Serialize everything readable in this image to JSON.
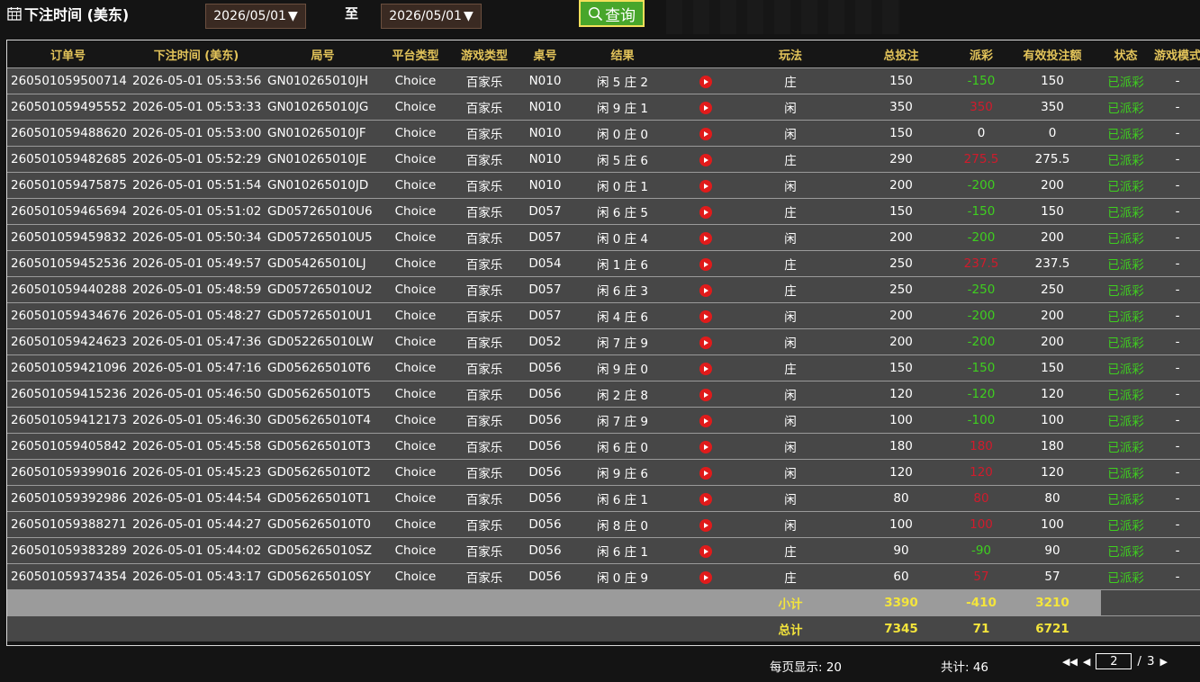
{
  "header": {
    "title": "下注时间 (美东)",
    "calendar_icon": "calendar-icon",
    "date_from": "2026/05/01",
    "to_label": "至",
    "date_to": "2026/05/01",
    "dropdown_glyph": "▼",
    "search_label": "查询",
    "search_icon": "search-icon"
  },
  "columns": [
    "订单号",
    "下注时间 (美东)",
    "局号",
    "平台类型",
    "游戏类型",
    "桌号",
    "结果",
    "",
    "玩法",
    "总投注",
    "派彩",
    "有效投注额",
    "状态",
    "游戏模式"
  ],
  "rows": [
    [
      "260501059500714",
      "2026-05-01 05:53:56",
      "GN010265010JH",
      "Choice",
      "百家乐",
      "N010",
      "闲 5 庄 2",
      "庄",
      "150",
      "-150",
      "150",
      "已派彩",
      "-"
    ],
    [
      "260501059495552",
      "2026-05-01 05:53:33",
      "GN010265010JG",
      "Choice",
      "百家乐",
      "N010",
      "闲 9 庄 1",
      "闲",
      "350",
      "350",
      "350",
      "已派彩",
      "-"
    ],
    [
      "260501059488620",
      "2026-05-01 05:53:00",
      "GN010265010JF",
      "Choice",
      "百家乐",
      "N010",
      "闲 0 庄 0",
      "闲",
      "150",
      "0",
      "0",
      "已派彩",
      "-"
    ],
    [
      "260501059482685",
      "2026-05-01 05:52:29",
      "GN010265010JE",
      "Choice",
      "百家乐",
      "N010",
      "闲 5 庄 6",
      "庄",
      "290",
      "275.5",
      "275.5",
      "已派彩",
      "-"
    ],
    [
      "260501059475875",
      "2026-05-01 05:51:54",
      "GN010265010JD",
      "Choice",
      "百家乐",
      "N010",
      "闲 0 庄 1",
      "闲",
      "200",
      "-200",
      "200",
      "已派彩",
      "-"
    ],
    [
      "260501059465694",
      "2026-05-01 05:51:02",
      "GD057265010U6",
      "Choice",
      "百家乐",
      "D057",
      "闲 6 庄 5",
      "庄",
      "150",
      "-150",
      "150",
      "已派彩",
      "-"
    ],
    [
      "260501059459832",
      "2026-05-01 05:50:34",
      "GD057265010U5",
      "Choice",
      "百家乐",
      "D057",
      "闲 0 庄 4",
      "闲",
      "200",
      "-200",
      "200",
      "已派彩",
      "-"
    ],
    [
      "260501059452536",
      "2026-05-01 05:49:57",
      "GD054265010LJ",
      "Choice",
      "百家乐",
      "D054",
      "闲 1 庄 6",
      "庄",
      "250",
      "237.5",
      "237.5",
      "已派彩",
      "-"
    ],
    [
      "260501059440288",
      "2026-05-01 05:48:59",
      "GD057265010U2",
      "Choice",
      "百家乐",
      "D057",
      "闲 6 庄 3",
      "庄",
      "250",
      "-250",
      "250",
      "已派彩",
      "-"
    ],
    [
      "260501059434676",
      "2026-05-01 05:48:27",
      "GD057265010U1",
      "Choice",
      "百家乐",
      "D057",
      "闲 4 庄 6",
      "闲",
      "200",
      "-200",
      "200",
      "已派彩",
      "-"
    ],
    [
      "260501059424623",
      "2026-05-01 05:47:36",
      "GD052265010LW",
      "Choice",
      "百家乐",
      "D052",
      "闲 7 庄 9",
      "闲",
      "200",
      "-200",
      "200",
      "已派彩",
      "-"
    ],
    [
      "260501059421096",
      "2026-05-01 05:47:16",
      "GD056265010T6",
      "Choice",
      "百家乐",
      "D056",
      "闲 9 庄 0",
      "庄",
      "150",
      "-150",
      "150",
      "已派彩",
      "-"
    ],
    [
      "260501059415236",
      "2026-05-01 05:46:50",
      "GD056265010T5",
      "Choice",
      "百家乐",
      "D056",
      "闲 2 庄 8",
      "闲",
      "120",
      "-120",
      "120",
      "已派彩",
      "-"
    ],
    [
      "260501059412173",
      "2026-05-01 05:46:30",
      "GD056265010T4",
      "Choice",
      "百家乐",
      "D056",
      "闲 7 庄 9",
      "闲",
      "100",
      "-100",
      "100",
      "已派彩",
      "-"
    ],
    [
      "260501059405842",
      "2026-05-01 05:45:58",
      "GD056265010T3",
      "Choice",
      "百家乐",
      "D056",
      "闲 6 庄 0",
      "闲",
      "180",
      "180",
      "180",
      "已派彩",
      "-"
    ],
    [
      "260501059399016",
      "2026-05-01 05:45:23",
      "GD056265010T2",
      "Choice",
      "百家乐",
      "D056",
      "闲 9 庄 6",
      "闲",
      "120",
      "120",
      "120",
      "已派彩",
      "-"
    ],
    [
      "260501059392986",
      "2026-05-01 05:44:54",
      "GD056265010T1",
      "Choice",
      "百家乐",
      "D056",
      "闲 6 庄 1",
      "闲",
      "80",
      "80",
      "80",
      "已派彩",
      "-"
    ],
    [
      "260501059388271",
      "2026-05-01 05:44:27",
      "GD056265010T0",
      "Choice",
      "百家乐",
      "D056",
      "闲 8 庄 0",
      "闲",
      "100",
      "100",
      "100",
      "已派彩",
      "-"
    ],
    [
      "260501059383289",
      "2026-05-01 05:44:02",
      "GD056265010SZ",
      "Choice",
      "百家乐",
      "D056",
      "闲 6 庄 1",
      "庄",
      "90",
      "-90",
      "90",
      "已派彩",
      "-"
    ],
    [
      "260501059374354",
      "2026-05-01 05:43:17",
      "GD056265010SY",
      "Choice",
      "百家乐",
      "D056",
      "闲 0 庄 9",
      "庄",
      "60",
      "57",
      "57",
      "已派彩",
      "-"
    ]
  ],
  "subtotal": {
    "label": "小计",
    "bet": "3390",
    "payout": "-410",
    "valid": "3210"
  },
  "total": {
    "label": "总计",
    "bet": "7345",
    "payout": "71",
    "valid": "6721"
  },
  "footer": {
    "per_page": "每页显示: 20",
    "count": "共计: 46",
    "first_glyph": "◀◀",
    "prev_glyph": "◀",
    "current_page": "2",
    "separator": "/",
    "total_pages": "3",
    "next_glyph": "▶"
  },
  "colors": {
    "payout_negative": "#3ecf1f",
    "payout_positive": "#d01b2c",
    "status": "#3ecf1f",
    "header_text": "#e3c45a",
    "summary_text": "#f4e53b",
    "search_button": "#48a62b"
  }
}
